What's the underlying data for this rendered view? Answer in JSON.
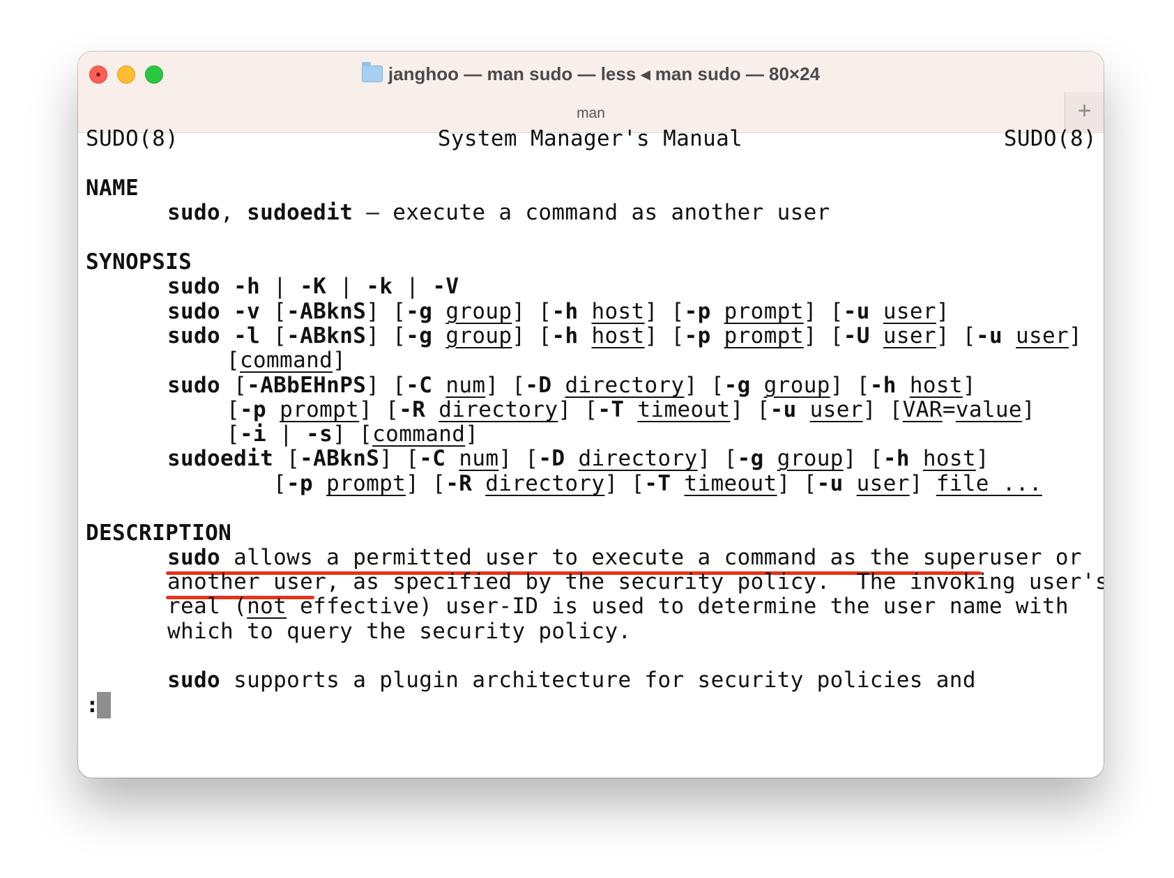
{
  "window": {
    "title": "janghoo — man sudo — less ◂ man sudo — 80×24",
    "tab_label": "man",
    "new_tab_label": "+"
  },
  "man": {
    "header_left": "SUDO(8)",
    "header_center": "System Manager's Manual",
    "header_right": "SUDO(8)",
    "name_heading": "NAME",
    "name_line": {
      "cmd1": "sudo",
      "comma": ",",
      "cmd2": "sudoedit",
      "rest": " – execute a command as another user"
    },
    "synopsis_heading": "SYNOPSIS",
    "synopsis": {
      "l1": {
        "a": "sudo -h",
        "b": " | ",
        "c": "-K",
        "d": " | ",
        "e": "-k",
        "f": " | ",
        "g": "-V"
      },
      "l2": {
        "cmd": "sudo -v",
        "p1": " [",
        "f1": "-ABknS",
        "p2": "] [",
        "f2": "-g",
        "p3": " ",
        "a2": "group",
        "p4": "] [",
        "f3": "-h",
        "p5": " ",
        "a3": "host",
        "p6": "] [",
        "f4": "-p",
        "p7": " ",
        "a4": "prompt",
        "p8": "] [",
        "f5": "-u",
        "p9": " ",
        "a5": "user",
        "p10": "]"
      },
      "l3": {
        "cmd": "sudo -l",
        "p1": " [",
        "f1": "-ABknS",
        "p2": "] [",
        "f2": "-g",
        "p3": " ",
        "a2": "group",
        "p4": "] [",
        "f3": "-h",
        "p5": " ",
        "a3": "host",
        "p6": "] [",
        "f4": "-p",
        "p7": " ",
        "a4": "prompt",
        "p8": "] [",
        "f5": "-U",
        "p9": " ",
        "a5": "user",
        "p10": "] [",
        "f6": "-u",
        "p11": " ",
        "a6": "user",
        "p12": "]"
      },
      "l4": {
        "p1": "[",
        "a1": "command",
        "p2": "]"
      },
      "l5": {
        "cmd": "sudo",
        "p1": " [",
        "f1": "-ABbEHnPS",
        "p2": "] [",
        "f2": "-C",
        "p3": " ",
        "a2": "num",
        "p4": "] [",
        "f3": "-D",
        "p5": " ",
        "a3": "directory",
        "p6": "] [",
        "f4": "-g",
        "p7": " ",
        "a4": "group",
        "p8": "] [",
        "f5": "-h",
        "p9": " ",
        "a5": "host",
        "p10": "]"
      },
      "l6": {
        "p1": "[",
        "f1": "-p",
        "p2": " ",
        "a1": "prompt",
        "p3": "] [",
        "f2": "-R",
        "p4": " ",
        "a2": "directory",
        "p5": "] [",
        "f3": "-T",
        "p6": " ",
        "a3": "timeout",
        "p7": "] [",
        "f4": "-u",
        "p8": " ",
        "a4": "user",
        "p9": "] [",
        "a5": "VAR",
        "eq": "=",
        "a6": "value",
        "p10": "]"
      },
      "l7": {
        "p1": "[",
        "f1": "-i",
        "p2": " | ",
        "f2": "-s",
        "p3": "] [",
        "a1": "command",
        "p4": "]"
      },
      "l8": {
        "cmd": "sudoedit",
        "p1": " [",
        "f1": "-ABknS",
        "p2": "] [",
        "f2": "-C",
        "p3": " ",
        "a2": "num",
        "p4": "] [",
        "f3": "-D",
        "p5": " ",
        "a3": "directory",
        "p6": "] [",
        "f4": "-g",
        "p7": " ",
        "a4": "group",
        "p8": "] [",
        "f5": "-h",
        "p9": " ",
        "a5": "host",
        "p10": "]"
      },
      "l9": {
        "p1": "[",
        "f1": "-p",
        "p2": " ",
        "a1": "prompt",
        "p3": "] [",
        "f2": "-R",
        "p4": " ",
        "a2": "directory",
        "p5": "] [",
        "f3": "-T",
        "p6": " ",
        "a3": "timeout",
        "p7": "] [",
        "f4": "-u",
        "p8": " ",
        "a4": "user",
        "p9": "] ",
        "a5": "file ..."
      }
    },
    "description_heading": "DESCRIPTION",
    "description": {
      "d1_cmd": "sudo",
      "d1_rest": " allows a permitted user to execute a command as the superuser or",
      "d2": "another user, as specified by the security policy.  The invoking user's",
      "d3_a": "real (",
      "d3_u": "not",
      "d3_b": " effective) user-ID is used to determine the user name with",
      "d4": "which to query the security policy.",
      "d5_cmd": "sudo",
      "d5_rest": " supports a plugin architecture for security policies and"
    },
    "prompt": ":",
    "highlight_color": "#e53418"
  }
}
